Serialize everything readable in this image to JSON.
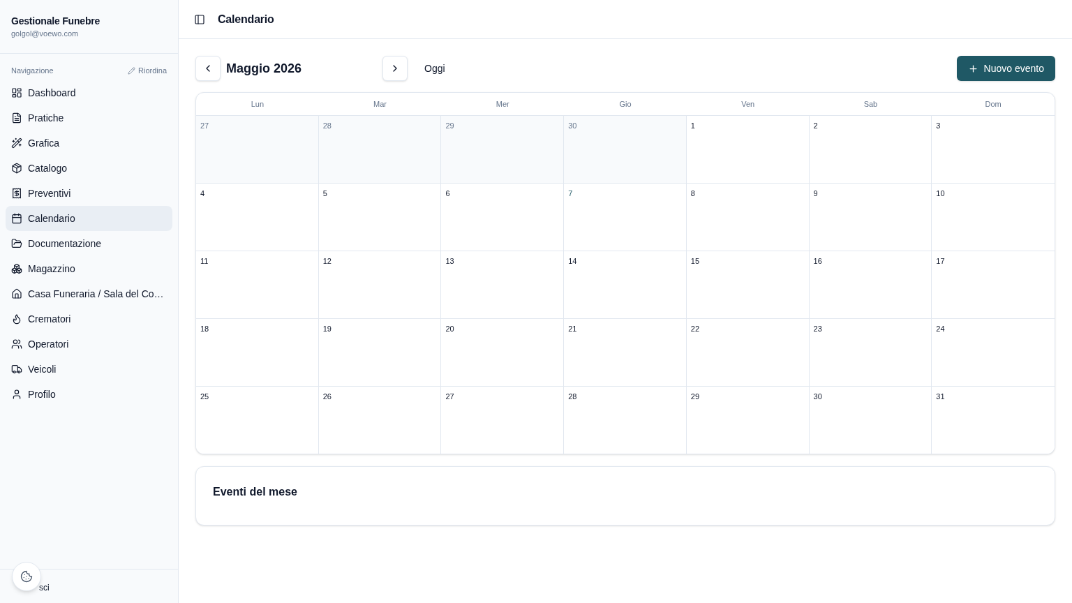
{
  "sidebar": {
    "app_name": "Gestionale Funebre",
    "email": "golgol@voewo.com",
    "nav_label": "Navigazione",
    "reorder": "Riordina",
    "items": [
      {
        "label": "Dashboard",
        "selected": false
      },
      {
        "label": "Pratiche",
        "selected": false
      },
      {
        "label": "Grafica",
        "selected": false
      },
      {
        "label": "Catalogo",
        "selected": false
      },
      {
        "label": "Preventivi",
        "selected": false
      },
      {
        "label": "Calendario",
        "selected": true
      },
      {
        "label": "Documentazione",
        "selected": false
      },
      {
        "label": "Magazzino",
        "selected": false
      },
      {
        "label": "Casa Funeraria / Sala del Co…",
        "selected": false
      },
      {
        "label": "Crematori",
        "selected": false
      },
      {
        "label": "Operatori",
        "selected": false
      },
      {
        "label": "Veicoli",
        "selected": false
      },
      {
        "label": "Profilo",
        "selected": false
      }
    ],
    "logout": "sci"
  },
  "header": {
    "title": "Calendario"
  },
  "toolbar": {
    "month": "Maggio 2026",
    "today": "Oggi",
    "new_event": "Nuovo evento"
  },
  "calendar": {
    "weekdays": [
      "Lun",
      "Mar",
      "Mer",
      "Gio",
      "Ven",
      "Sab",
      "Dom"
    ],
    "weeks": [
      {
        "days": [
          {
            "day": "27",
            "outside": true,
            "today": false
          },
          {
            "day": "28",
            "outside": true,
            "today": false
          },
          {
            "day": "29",
            "outside": true,
            "today": false
          },
          {
            "day": "30",
            "outside": true,
            "today": false
          },
          {
            "day": "1",
            "outside": false,
            "today": false
          },
          {
            "day": "2",
            "outside": false,
            "today": false
          },
          {
            "day": "3",
            "outside": false,
            "today": false
          }
        ]
      },
      {
        "days": [
          {
            "day": "4",
            "outside": false,
            "today": false
          },
          {
            "day": "5",
            "outside": false,
            "today": false
          },
          {
            "day": "6",
            "outside": false,
            "today": false
          },
          {
            "day": "7",
            "outside": false,
            "today": true
          },
          {
            "day": "8",
            "outside": false,
            "today": false
          },
          {
            "day": "9",
            "outside": false,
            "today": false
          },
          {
            "day": "10",
            "outside": false,
            "today": false
          }
        ]
      },
      {
        "days": [
          {
            "day": "11",
            "outside": false,
            "today": false
          },
          {
            "day": "12",
            "outside": false,
            "today": false
          },
          {
            "day": "13",
            "outside": false,
            "today": false
          },
          {
            "day": "14",
            "outside": false,
            "today": false
          },
          {
            "day": "15",
            "outside": false,
            "today": false
          },
          {
            "day": "16",
            "outside": false,
            "today": false
          },
          {
            "day": "17",
            "outside": false,
            "today": false
          }
        ]
      },
      {
        "days": [
          {
            "day": "18",
            "outside": false,
            "today": false
          },
          {
            "day": "19",
            "outside": false,
            "today": false
          },
          {
            "day": "20",
            "outside": false,
            "today": false
          },
          {
            "day": "21",
            "outside": false,
            "today": false
          },
          {
            "day": "22",
            "outside": false,
            "today": false
          },
          {
            "day": "23",
            "outside": false,
            "today": false
          },
          {
            "day": "24",
            "outside": false,
            "today": false
          }
        ]
      },
      {
        "days": [
          {
            "day": "25",
            "outside": false,
            "today": false
          },
          {
            "day": "26",
            "outside": false,
            "today": false
          },
          {
            "day": "27",
            "outside": false,
            "today": false
          },
          {
            "day": "28",
            "outside": false,
            "today": false
          },
          {
            "day": "29",
            "outside": false,
            "today": false
          },
          {
            "day": "30",
            "outside": false,
            "today": false
          },
          {
            "day": "31",
            "outside": false,
            "today": false
          }
        ]
      }
    ]
  },
  "events_panel": {
    "title": "Eventi del mese"
  }
}
